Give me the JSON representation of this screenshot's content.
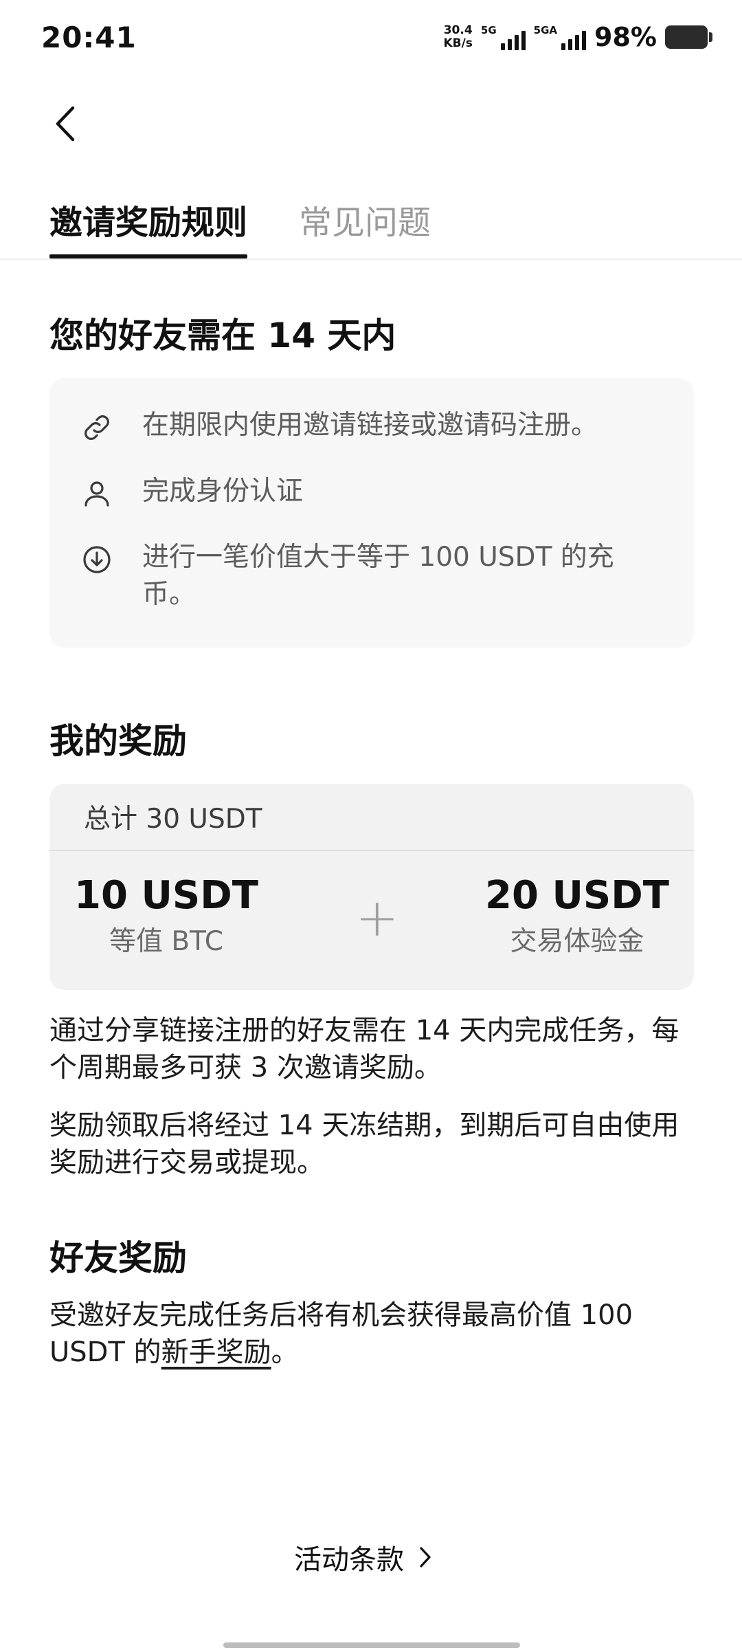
{
  "status_bar": {
    "time": "20:41",
    "net_speed_value": "30.4",
    "net_speed_unit": "KB/s",
    "signal1_label": "5G",
    "signal2_label": "5GA",
    "battery": "98%"
  },
  "nav": {
    "back_icon": "chevron-left-icon"
  },
  "tabs": [
    {
      "label": "邀请奖励规则",
      "active": true
    },
    {
      "label": "常见问题",
      "active": false
    }
  ],
  "section_requirements": {
    "title": "您的好友需在 14 天内",
    "items": [
      {
        "icon": "link-icon",
        "text": "在期限内使用邀请链接或邀请码注册。"
      },
      {
        "icon": "user-icon",
        "text": "完成身份认证"
      },
      {
        "icon": "deposit-icon",
        "text": "进行一笔价值大于等于 100 USDT 的充币。"
      }
    ]
  },
  "section_rewards": {
    "title": "我的奖励",
    "total": "总计 30 USDT",
    "left_amount": "10 USDT",
    "left_label": "等值 BTC",
    "plus": "+",
    "right_amount": "20 USDT",
    "right_label": "交易体验金",
    "para1": "通过分享链接注册的好友需在 14 天内完成任务，每个周期最多可获 3 次邀请奖励。",
    "para2": "奖励领取后将经过 14 天冻结期，到期后可自由使用奖励进行交易或提现。"
  },
  "section_friend": {
    "title": "好友奖励",
    "text_before": "受邀好友完成任务后将有机会获得最高价值 100 USDT 的",
    "link_text": "新手奖励",
    "text_after": "。"
  },
  "footer": {
    "terms_label": "活动条款",
    "terms_icon": "chevron-right-icon"
  },
  "colors": {
    "text_primary": "#111111",
    "text_secondary": "#5c5c5c",
    "tab_inactive": "#9a9a9a",
    "card_bg": "#f7f7f7",
    "reward_bg": "#f2f2f2"
  }
}
